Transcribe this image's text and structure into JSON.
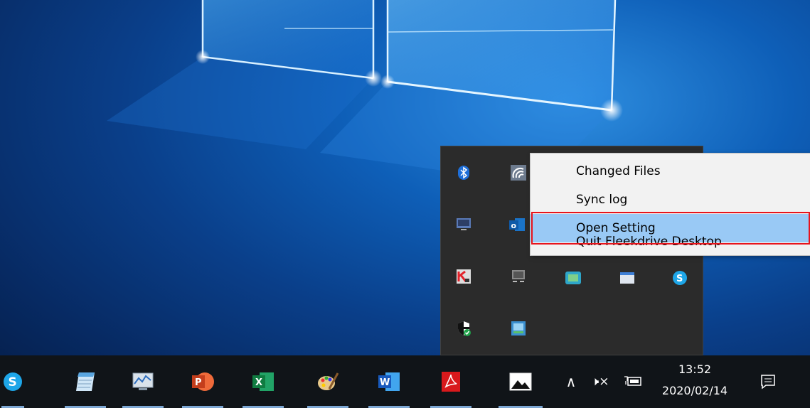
{
  "context_menu": {
    "items": [
      {
        "label": "Changed Files"
      },
      {
        "label": "Sync log"
      },
      {
        "label": "Open Setting",
        "highlighted": true
      },
      {
        "label": "Quit Fleekdrive Desktop"
      }
    ]
  },
  "tray_overflow": {
    "icons": [
      "bluetooth-icon",
      "fleekdrive-icon",
      "display-icon",
      "outlook-icon",
      "kaspersky-icon",
      "monitor-icon",
      "network-icon",
      "window-icon",
      "skype-icon",
      "defender-icon",
      "vpn-icon"
    ]
  },
  "taskbar": {
    "pinned_apps": [
      "skype-icon",
      "notepad-icon",
      "performance-monitor-icon",
      "powerpoint-icon",
      "excel-icon",
      "paint-icon",
      "word-icon",
      "acrobat-icon",
      "photos-icon"
    ],
    "tray": {
      "chevron": "∧",
      "volume": "🕨×",
      "clock_time": "13:52",
      "clock_date": "2020/02/14"
    }
  },
  "colors": {
    "highlight_border": "#e8141c",
    "menu_hover": "#99c9f5",
    "taskbar_bg": "#101418",
    "flyout_bg": "#2b2b2b"
  }
}
